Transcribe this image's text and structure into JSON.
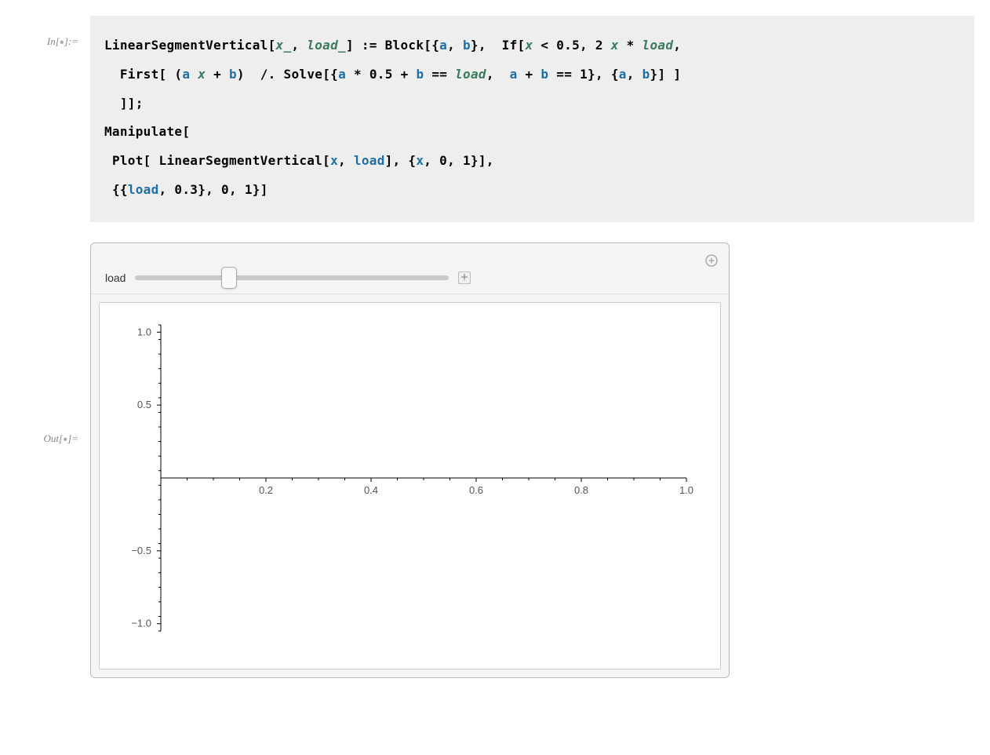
{
  "in_label_prefix": "In[",
  "in_label_suffix": "]:=",
  "out_label_prefix": "Out[",
  "out_label_suffix": "]=",
  "code": {
    "line1": {
      "fn_name": "LinearSegmentVertical",
      "x_pat": "x_",
      "load_pat": "load_",
      "assign": " := ",
      "block_kw": "Block",
      "vars_a": "a",
      "vars_b": "b",
      "if_kw": "If",
      "x": "x",
      "half": "0.5",
      "two": "2",
      "load": "load"
    },
    "line2": {
      "first_kw": "First",
      "a": "a",
      "x": "x",
      "b": "b",
      "replace": " /. ",
      "solve_kw": "Solve",
      "half": "0.5",
      "eq": " == ",
      "load": "load",
      "one": "1"
    },
    "line3": "]];",
    "line4": "Manipulate[",
    "line5": {
      "plot_kw": "Plot",
      "fn": "LinearSegmentVertical",
      "x": "x",
      "load": "load",
      "range_lo": "0",
      "range_hi": "1"
    },
    "line6": {
      "load": "load",
      "init": "0.3",
      "lo": "0",
      "hi": "1"
    }
  },
  "manipulate": {
    "control_label": "load",
    "slider_min": 0,
    "slider_max": 1,
    "slider_value": 0.3
  },
  "chart_data": {
    "type": "line",
    "title": "",
    "xlabel": "",
    "ylabel": "",
    "xlim": [
      0,
      1
    ],
    "ylim": [
      -1.05,
      1.05
    ],
    "xticks": [
      0.2,
      0.4,
      0.6,
      0.8,
      1.0
    ],
    "yticks": [
      -1.0,
      -0.5,
      0.5,
      1.0
    ],
    "series": []
  }
}
